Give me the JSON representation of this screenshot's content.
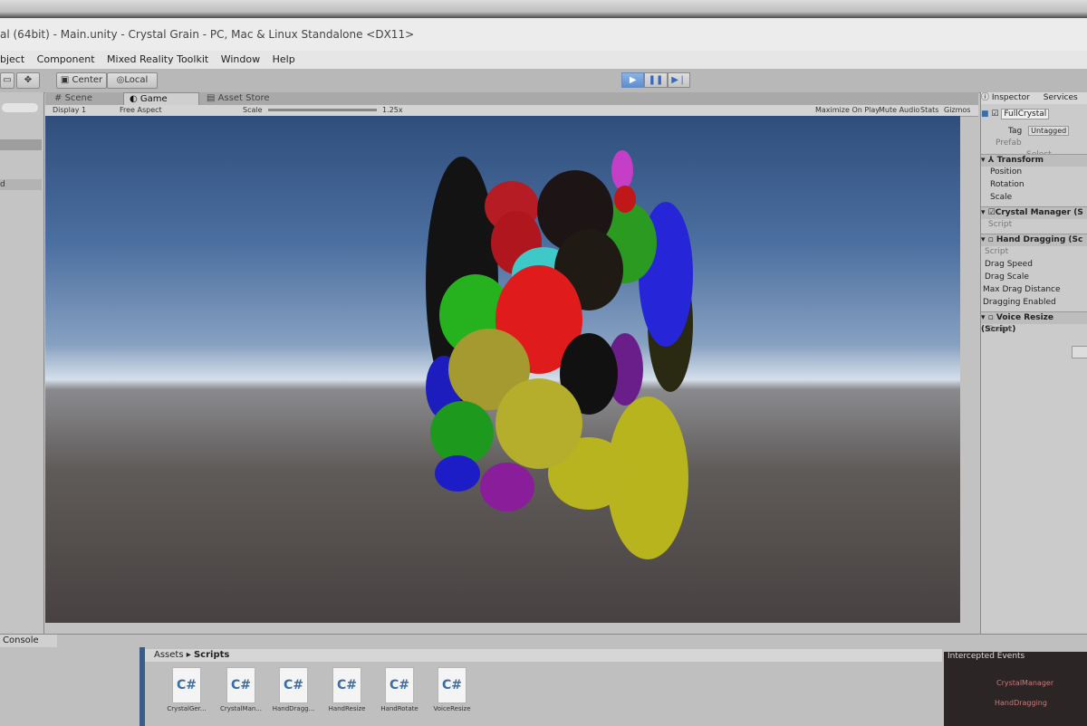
{
  "window": {
    "title": "al (64bit) - Main.unity - Crystal Grain - PC, Mac & Linux Standalone <DX11>"
  },
  "menu": [
    "bject",
    "Component",
    "Mixed Reality Toolkit",
    "Window",
    "Help"
  ],
  "toolbar": {
    "pivot_label": "Center",
    "space_label": "Local",
    "play_icon": "play-icon",
    "pause_icon": "pause-icon",
    "step_icon": "step-icon"
  },
  "tabs": {
    "scene": "Scene",
    "game": "Game",
    "asset_store": "Asset Store"
  },
  "game_bar": {
    "display": "Display 1",
    "aspect": "Free Aspect",
    "scale_label": "Scale",
    "scale_value": "1.25x",
    "maximize": "Maximize On Play",
    "mute": "Mute Audio",
    "stats": "Stats",
    "gizmos": "Gizmos"
  },
  "left_panel": {
    "item": "d"
  },
  "inspector": {
    "tab": "Inspector",
    "tab2": "Services",
    "object_name": "FullCrystal",
    "tag_label": "Tag",
    "tag_value": "Untagged",
    "prefab_label": "Prefab",
    "prefab_select": "Select",
    "transform": "Transform",
    "transform_fields": [
      "Position",
      "Rotation",
      "Scale"
    ],
    "crystal_manager": "Crystal Manager (S",
    "script_label": "Script",
    "hand_dragging": "Hand Dragging (Sc",
    "hand_fields": [
      "Script",
      "Drag Speed",
      "Drag Scale",
      "Max Drag Distance",
      "Dragging Enabled"
    ],
    "voice_resize": "Voice Resize (Script)",
    "voice_script": "Script"
  },
  "bottom": {
    "console_tab": "Console",
    "path_root": "Assets",
    "path_sep": "▸",
    "path_leaf": "Scripts",
    "files": [
      "CrystalGer...",
      "CrystalMan...",
      "HandDragg...",
      "HandResize",
      "HandRotate",
      "VoiceResize"
    ],
    "file_icon_text": "C#",
    "intercepted_title": "Intercepted Events",
    "intercepted_items": [
      "CrystalManager",
      "HandDragging"
    ]
  },
  "colors": {
    "play_blue": "#5d8ed0",
    "panel_gray": "#c4c4c4",
    "sky_top": "#2f4e7c",
    "ground": "#474241"
  }
}
